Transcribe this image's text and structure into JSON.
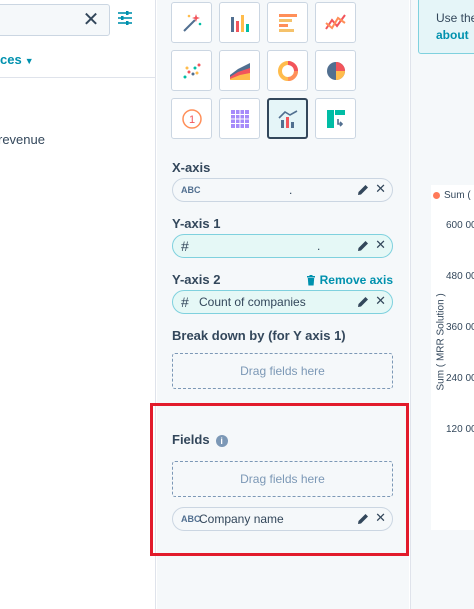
{
  "left": {
    "sources_label": "ces",
    "revenue_item": "revenue"
  },
  "chart_types": [
    {
      "name": "chart-type-magic-wand",
      "icon": "magic-wand-icon"
    },
    {
      "name": "chart-type-vertical-bar",
      "icon": "vertical-bar-icon"
    },
    {
      "name": "chart-type-horizontal-bar",
      "icon": "horizontal-bar-icon"
    },
    {
      "name": "chart-type-line",
      "icon": "line-chart-icon"
    },
    {
      "name": "chart-type-scatter",
      "icon": "scatter-icon"
    },
    {
      "name": "chart-type-area",
      "icon": "area-chart-icon"
    },
    {
      "name": "chart-type-donut",
      "icon": "donut-icon"
    },
    {
      "name": "chart-type-pie",
      "icon": "pie-chart-icon"
    },
    {
      "name": "chart-type-summary",
      "icon": "summary-number-icon",
      "glyph": "1"
    },
    {
      "name": "chart-type-table",
      "icon": "table-icon"
    },
    {
      "name": "chart-type-combination",
      "icon": "combination-chart-icon",
      "selected": true
    },
    {
      "name": "chart-type-pivot",
      "icon": "pivot-table-icon"
    }
  ],
  "xaxis": {
    "label": "X-axis",
    "pill_type": "ABC",
    "pill_text": "."
  },
  "yaxis1": {
    "label": "Y-axis 1",
    "pill_type": "#",
    "pill_text": "."
  },
  "yaxis2": {
    "label": "Y-axis 2",
    "remove_label": "Remove axis",
    "pill_type": "#",
    "pill_text": "Count of companies"
  },
  "breakdown": {
    "label": "Break down by (for Y axis 1)",
    "drag_text": "Drag fields here"
  },
  "fields": {
    "label": "Fields",
    "info": "i",
    "drag_text": "Drag fields here",
    "pill_type": "ABC",
    "pill_text": "Company name"
  },
  "right": {
    "tooltip_text": "Use the",
    "tooltip_link": "about",
    "legend_label": "Sum (",
    "y_axis_label": "Sum ( MRR Solution )",
    "y_ticks": [
      "600 00",
      "480 00",
      "360 00",
      "240 00",
      "120 00"
    ]
  },
  "colors": {
    "accent": "#0091ae",
    "highlight": "#e21b2b",
    "series": "#ff7a59"
  }
}
